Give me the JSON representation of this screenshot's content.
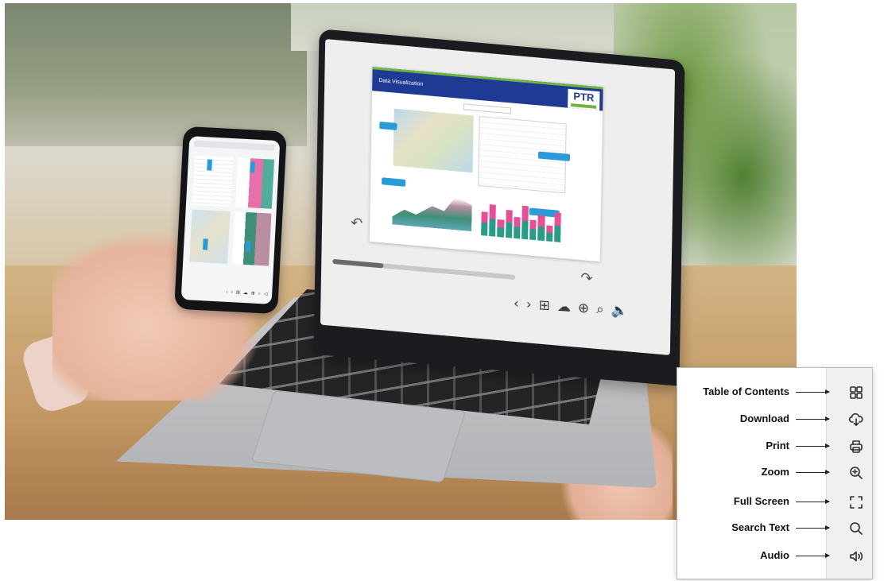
{
  "laptop_screen": {
    "slide_title": "Data Visualization",
    "logo": "PTR",
    "toolbar_icons": [
      "chevron-left-icon",
      "chevron-right-icon",
      "grid-icon",
      "cloud-download-icon",
      "zoom-in-icon",
      "search-icon",
      "audio-icon"
    ]
  },
  "legend": {
    "items": [
      {
        "label": "Table of Contents",
        "icon": "table-of-contents-icon"
      },
      {
        "label": "Download",
        "icon": "download-icon"
      },
      {
        "label": "Print",
        "icon": "print-icon"
      },
      {
        "label": "Zoom",
        "icon": "zoom-icon"
      },
      {
        "label": "Full Screen",
        "icon": "full-screen-icon"
      },
      {
        "label": "Search Text",
        "icon": "search-text-icon"
      },
      {
        "label": "Audio",
        "icon": "audio-icon"
      }
    ]
  },
  "colors": {
    "slide_header": "#1f3a93",
    "slide_accent": "#6fb43f",
    "chart_pink": "#e54f97",
    "chart_teal": "#2a9b86",
    "button_blue": "#2a9ad8"
  }
}
